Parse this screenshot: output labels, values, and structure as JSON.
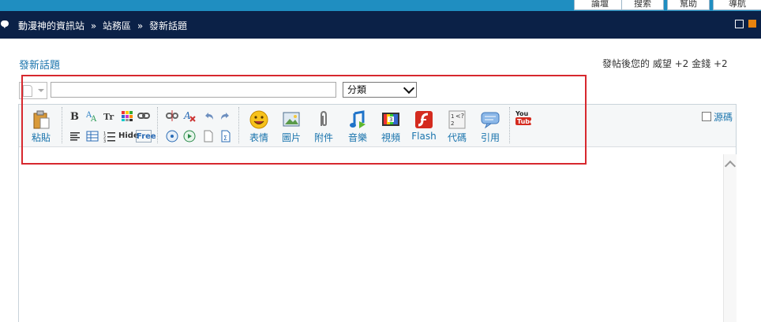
{
  "top_buttons": [
    "論壇",
    "搜索",
    "幫助",
    "導航"
  ],
  "breadcrumb": {
    "site": "動漫神的資訊站",
    "sep": "»",
    "forum": "站務區",
    "current": "發新話題"
  },
  "page": {
    "title": "發新話題",
    "reward_text": "發帖後您的 威望 +2  金錢 +2"
  },
  "form": {
    "subject_value": "",
    "category_selected": "分類"
  },
  "toolbar": {
    "paste": "粘貼",
    "emoticons": "表情",
    "image": "圖片",
    "attachment": "附件",
    "music": "音樂",
    "video": "視頻",
    "flash": "Flash",
    "code": "代碼",
    "quote": "引用",
    "source": "源碼",
    "youtube_logo": "You Tube",
    "hide_label": "Hide",
    "free_label": "Free"
  },
  "colors": {
    "accent": "#1a74ad",
    "navbar": "#0b2147",
    "topbar": "#1f8ec1",
    "highlight": "#d7282e",
    "orange": "#e8830f"
  }
}
